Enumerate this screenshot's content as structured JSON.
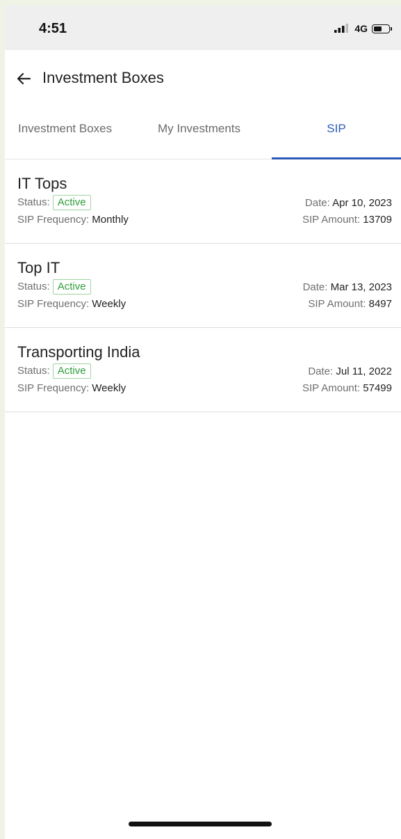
{
  "statusbar": {
    "time": "4:51",
    "network": "4G"
  },
  "header": {
    "title": "Investment Boxes"
  },
  "tabs": [
    {
      "label": "Investment Boxes",
      "active": false
    },
    {
      "label": "My Investments",
      "active": false
    },
    {
      "label": "SIP",
      "active": true
    }
  ],
  "labels": {
    "status": "Status:",
    "frequency": "SIP Frequency:",
    "date": "Date:",
    "amount": "SIP Amount:"
  },
  "sips": [
    {
      "name": "IT Tops",
      "status": "Active",
      "frequency": "Monthly",
      "date": "Apr 10, 2023",
      "amount": "13709"
    },
    {
      "name": "Top IT",
      "status": "Active",
      "frequency": "Weekly",
      "date": "Mar 13, 2023",
      "amount": "8497"
    },
    {
      "name": "Transporting India",
      "status": "Active",
      "frequency": "Weekly",
      "date": "Jul 11, 2022",
      "amount": "57499"
    }
  ],
  "colors": {
    "accent": "#2a5ab8",
    "active_badge": "#2e9e3a"
  },
  "icons": {
    "back": "arrow-left-icon",
    "signal": "signal-icon",
    "battery": "battery-icon"
  }
}
